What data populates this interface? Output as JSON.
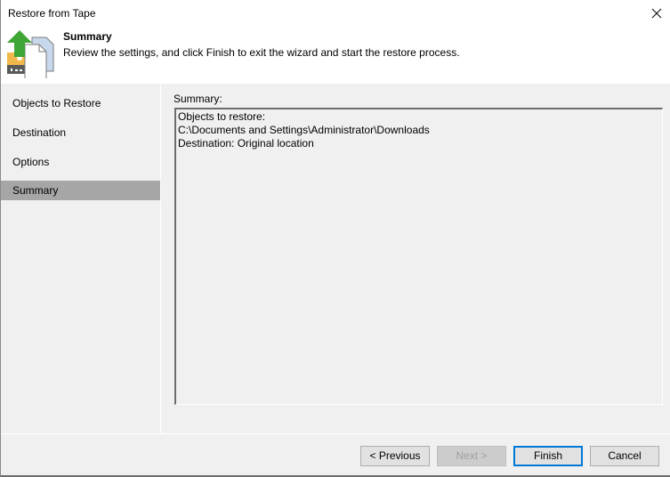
{
  "window": {
    "title": "Restore from Tape",
    "close_icon": "close-icon"
  },
  "header": {
    "icon": "restore-tape-icon",
    "title": "Summary",
    "description": "Review the settings, and click Finish to exit the wizard and start the restore process."
  },
  "sidebar": {
    "items": [
      {
        "label": "Objects to Restore",
        "active": false
      },
      {
        "label": "Destination",
        "active": false
      },
      {
        "label": "Options",
        "active": false
      },
      {
        "label": "Summary",
        "active": true
      }
    ]
  },
  "main": {
    "summary_label": "Summary:",
    "summary_text": "Objects to restore:\nC:\\Documents and Settings\\Administrator\\Downloads\nDestination: Original location"
  },
  "footer": {
    "previous_label": "< Previous",
    "next_label": "Next >",
    "finish_label": "Finish",
    "cancel_label": "Cancel"
  },
  "colors": {
    "accent": "#0078d7",
    "active_nav": "#a6a6a6",
    "arrow_green": "#3fa535"
  }
}
